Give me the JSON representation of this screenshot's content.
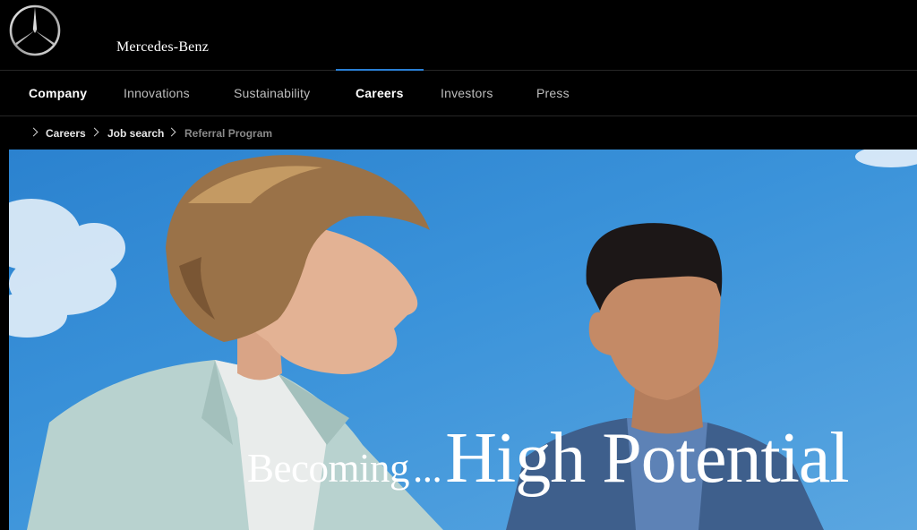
{
  "brand": {
    "name": "Mercedes-Benz",
    "logo_icon": "three-pointed-star-icon"
  },
  "nav": {
    "items": [
      {
        "label": "Company",
        "bold": true
      },
      {
        "label": "Innovations"
      },
      {
        "label": "Sustainability"
      },
      {
        "label": "Careers",
        "bold": true,
        "active": true
      },
      {
        "label": "Investors"
      },
      {
        "label": "Press"
      }
    ],
    "accent_color": "#2a7fd4"
  },
  "breadcrumb": {
    "home_icon": "home-icon",
    "items": [
      "Careers",
      "Job search",
      "Referral Program"
    ]
  },
  "hero": {
    "headline_part1": "Becoming",
    "headline_ellipsis": "...",
    "headline_part2": "High Potential"
  }
}
